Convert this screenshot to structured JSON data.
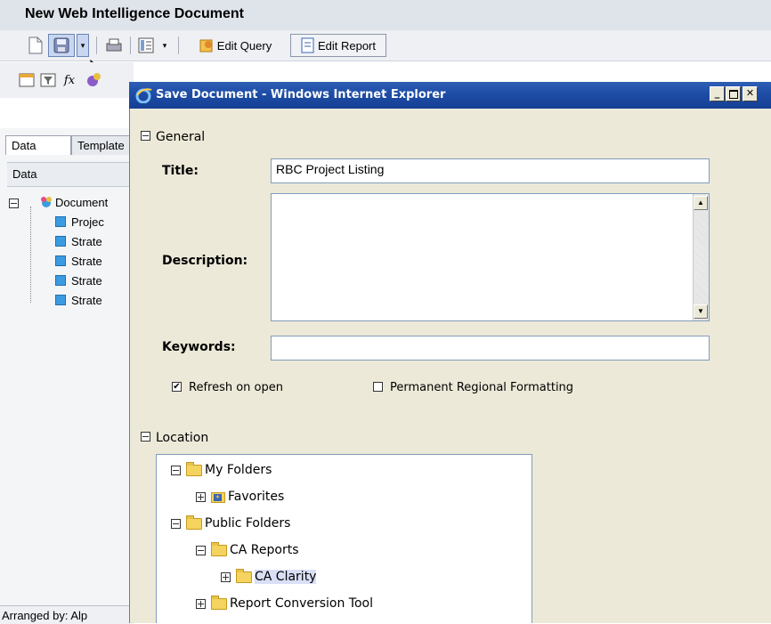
{
  "app": {
    "title": "New Web Intelligence Document",
    "toolbar": {
      "edit_query": "Edit Query",
      "edit_report": "Edit Report"
    },
    "left_tabs": [
      "Data",
      "Template"
    ],
    "data_bar_label": "Data",
    "tree_root": "Document",
    "tree_items": [
      "Projec",
      "Strate",
      "Strate",
      "Strate",
      "Strate"
    ],
    "status_text": "Arranged by: Alp"
  },
  "dialog": {
    "title": "Save Document - Windows Internet Explorer",
    "sections": {
      "general": "General",
      "location": "Location"
    },
    "fields": {
      "title_label": "Title:",
      "title_value": "RBC Project Listing",
      "description_label": "Description:",
      "description_value": "",
      "keywords_label": "Keywords:",
      "keywords_value": ""
    },
    "options": {
      "refresh_label": "Refresh on open",
      "refresh_checked": true,
      "regional_label": "Permanent Regional Formatting",
      "regional_checked": false
    },
    "location_tree": [
      {
        "label": "My Folders",
        "level": 0,
        "expanded": true
      },
      {
        "label": "Favorites",
        "level": 1,
        "expanded": false
      },
      {
        "label": "Public Folders",
        "level": 0,
        "expanded": true
      },
      {
        "label": "CA Reports",
        "level": 1,
        "expanded": true
      },
      {
        "label": "CA Clarity",
        "level": 2,
        "expanded": false,
        "selected": true
      },
      {
        "label": "Report Conversion Tool",
        "level": 1,
        "expanded": false
      }
    ]
  },
  "colors": {
    "dialog_title_bar": "#1f4ea8",
    "dialog_bg": "#ece9d8",
    "field_border": "#7f9db9"
  }
}
